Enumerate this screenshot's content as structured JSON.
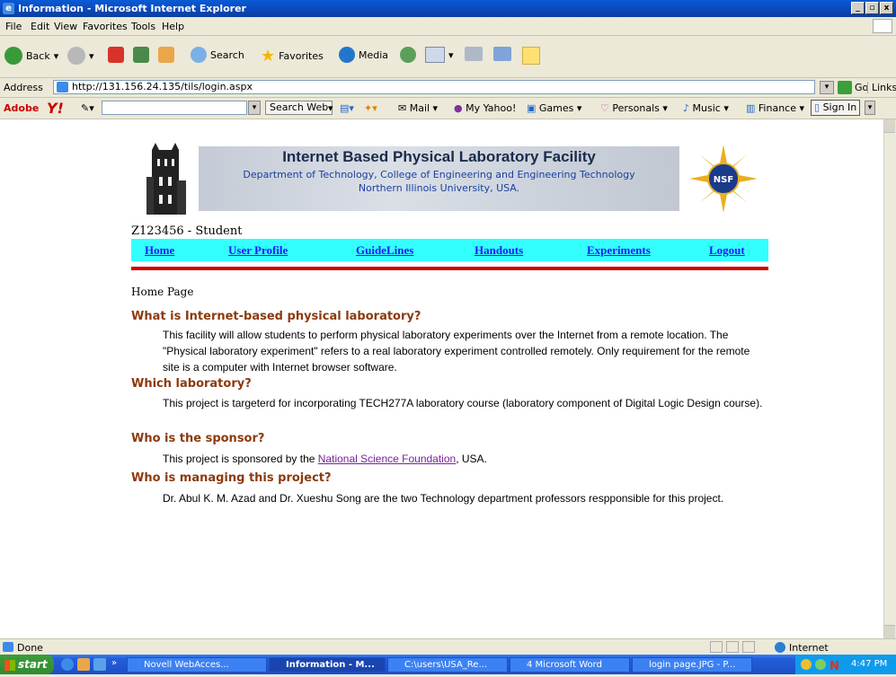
{
  "window": {
    "title": "Information - Microsoft Internet Explorer",
    "buttons": [
      "_",
      "▫",
      "x"
    ]
  },
  "menu": [
    "File",
    "Edit",
    "View",
    "Favorites",
    "Tools",
    "Help"
  ],
  "toolbar": {
    "back": "Back",
    "search": "Search",
    "favorites": "Favorites",
    "media": "Media"
  },
  "address": {
    "label": "Address",
    "url": "http://131.156.24.135/tils/login.aspx",
    "go": "Go",
    "links": "Links"
  },
  "yahoo": {
    "adobe": "Adobe",
    "search_web": "Search Web",
    "mail": "Mail",
    "my_yahoo": "My Yahoo!",
    "games": "Games",
    "personals": "Personals",
    "music": "Music",
    "finance": "Finance",
    "sign_in": "Sign In"
  },
  "banner": {
    "title": "Internet Based Physical Laboratory Facility",
    "line2": "Department of Technology, College of Engineering and Engineering Technology",
    "line3": "Northern Illinois University, USA.",
    "nsf": "NSF"
  },
  "user": "Z123456 - Student",
  "nav": [
    "Home",
    "User Profile",
    "GuideLines",
    "Handouts",
    "Experiments",
    "Logout"
  ],
  "page_title": "Home Page",
  "sections": [
    {
      "heading": "What is Internet-based physical laboratory?",
      "text": "This facility will allow students to perform physical laboratory experiments over the Internet from a remote location. The \"Physical laboratory experiment\" refers to a real laboratory experiment controlled remotely. Only requirement for the remote site is a computer with Internet browser software."
    },
    {
      "heading": "Which laboratory?",
      "text": "This project is targeterd for incorporating TECH277A laboratory course (laboratory component of Digital Logic Design course)."
    },
    {
      "heading": "Who is the sponsor?",
      "text_before": "This project is sponsored by the ",
      "link": "National Science Foundation",
      "text_after": ", USA."
    },
    {
      "heading": "Who is managing this project?",
      "text": "Dr. Abul K. M. Azad and Dr. Xueshu Song are the two Technology department professors respponsible for this project."
    }
  ],
  "status": {
    "left": "Done",
    "zone": "Internet"
  },
  "taskbar": {
    "start": "start",
    "tasks": [
      "Novell WebAcces...",
      "Information - M...",
      "C:\\users\\USA_Re...",
      "4 Microsoft Word",
      "login page.JPG - P..."
    ],
    "time": "4:47 PM"
  }
}
